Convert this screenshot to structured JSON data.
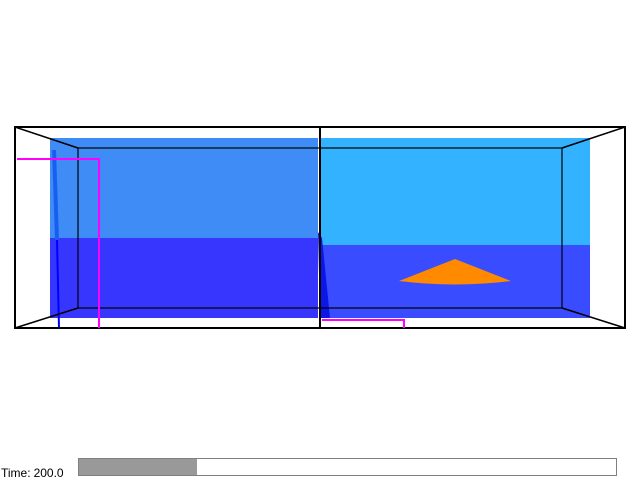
{
  "time_readout": {
    "label": "Time:",
    "value": "200.0"
  },
  "playback": {
    "progress_fraction": 0.22
  },
  "colors": {
    "water_upper_left": "#3f8cf7",
    "water_upper_right": "#33b3ff",
    "water_lower": "#3636ff",
    "interface_sheet": "#0d16e8",
    "sediment_wedge": "#ff8a00",
    "probe_lines": "#ff00ff",
    "tank_outline": "#000000",
    "progress_fill": "#999999"
  }
}
